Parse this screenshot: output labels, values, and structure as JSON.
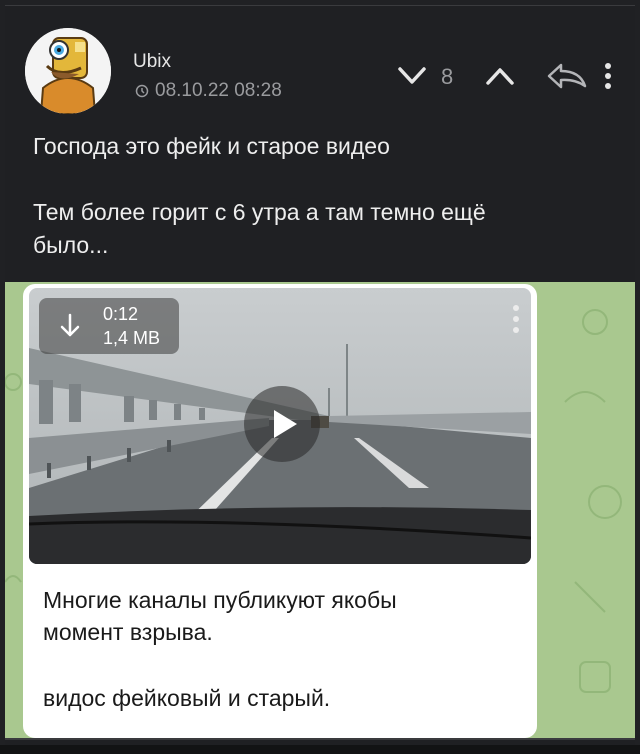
{
  "post": {
    "username": "Ubix",
    "timestamp": "08.10.22 08:28",
    "score": "8",
    "text_line1": "Господа это фейк и старое видео",
    "text_line2a": "Тем более горит с 6 утра а там темно ещё",
    "text_line2b": "было..."
  },
  "media": {
    "video_duration": "0:12",
    "video_size": "1,4 MB",
    "caption_line1": "Многие каналы публикуют якобы",
    "caption_line2": "момент взрыва.",
    "caption_line3": "видос фейковый и старый."
  },
  "colors": {
    "background": "#1f2023",
    "text": "#eeeeee",
    "muted": "#9a9b9e",
    "telegram_bg": "#a9c88f"
  }
}
